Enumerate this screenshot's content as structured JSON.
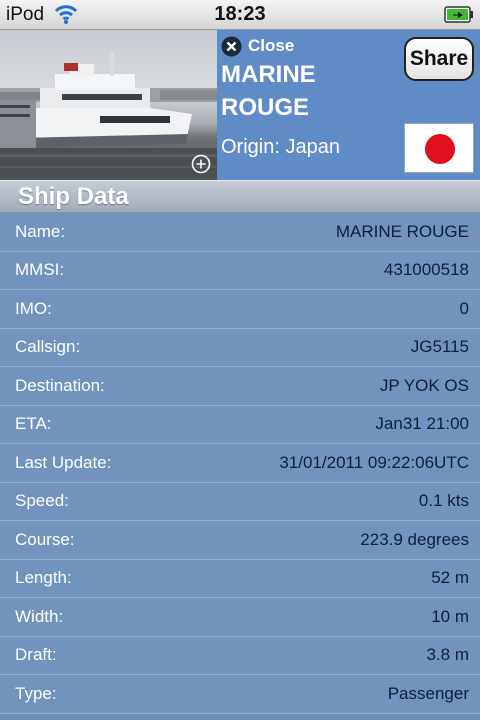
{
  "status_bar": {
    "carrier": "iPod",
    "time": "18:23"
  },
  "header": {
    "close_label": "Close",
    "ship_name": "MARINE ROUGE",
    "origin": "Origin: Japan",
    "share_label": "Share",
    "flag_country": "Japan"
  },
  "section": {
    "title": "Ship Data"
  },
  "rows": [
    {
      "label": "Name:",
      "value": "MARINE ROUGE"
    },
    {
      "label": "MMSI:",
      "value": "431000518"
    },
    {
      "label": "IMO:",
      "value": "0"
    },
    {
      "label": "Callsign:",
      "value": "JG5115"
    },
    {
      "label": "Destination:",
      "value": "JP YOK OS"
    },
    {
      "label": "ETA:",
      "value": "Jan31 21:00"
    },
    {
      "label": "Last Update:",
      "value": "31/01/2011 09:22:06UTC"
    },
    {
      "label": "Speed:",
      "value": "0.1 kts"
    },
    {
      "label": "Course:",
      "value": "223.9 degrees"
    },
    {
      "label": "Length:",
      "value": "52 m"
    },
    {
      "label": "Width:",
      "value": "10 m"
    },
    {
      "label": "Draft:",
      "value": "3.8 m"
    },
    {
      "label": "Type:",
      "value": "Passenger"
    }
  ],
  "colors": {
    "info_panel": "#5f8cc7",
    "row_background": "#7293bd",
    "flag_red": "#e0101c"
  }
}
